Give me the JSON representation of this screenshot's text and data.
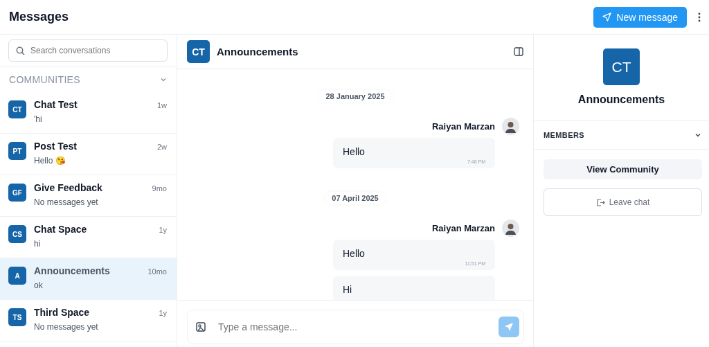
{
  "header": {
    "title": "Messages",
    "new_button": "New message"
  },
  "search": {
    "placeholder": "Search conversations"
  },
  "section": {
    "label": "COMMUNITIES",
    "expanded": true
  },
  "conversations": [
    {
      "initials": "CT",
      "name": "Chat Test",
      "time": "1w",
      "preview": "'hi",
      "selected": false
    },
    {
      "initials": "PT",
      "name": "Post Test",
      "time": "2w",
      "preview": "Hello 😘",
      "selected": false
    },
    {
      "initials": "GF",
      "name": "Give Feedback",
      "time": "9mo",
      "preview": "No messages yet",
      "selected": false
    },
    {
      "initials": "CS",
      "name": "Chat Space",
      "time": "1y",
      "preview": "hi",
      "selected": false
    },
    {
      "initials": "A",
      "name": "Announcements",
      "time": "10mo",
      "preview": "ok",
      "selected": true
    },
    {
      "initials": "TS",
      "name": "Third Space",
      "time": "1y",
      "preview": "No messages yet",
      "selected": false
    }
  ],
  "chat": {
    "initials": "CT",
    "title": "Announcements",
    "groups": [
      {
        "date": "28 January 2025",
        "sender": "Raiyan Marzan",
        "bubbles": [
          {
            "text": "Hello",
            "time": "7:48 PM"
          }
        ]
      },
      {
        "date": "07 April 2025",
        "sender": "Raiyan Marzan",
        "bubbles": [
          {
            "text": "Hello",
            "time": "11:51 PM"
          },
          {
            "text": "Hi"
          }
        ]
      }
    ],
    "composer": {
      "placeholder": "Type a message..."
    }
  },
  "details": {
    "initials": "CT",
    "title": "Announcements",
    "members_label": "MEMBERS",
    "members_expanded": false,
    "view_button": "View Community",
    "leave_button": "Leave chat"
  }
}
